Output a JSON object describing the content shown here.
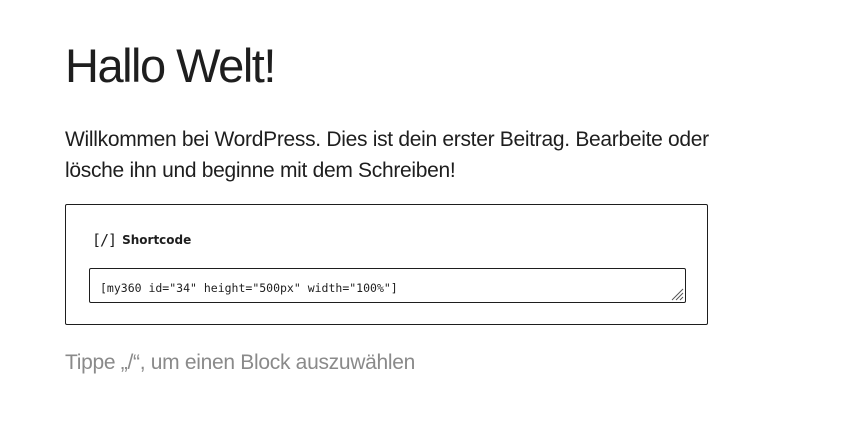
{
  "post": {
    "title": "Hallo Welt!",
    "paragraph": "Willkommen bei WordPress. Dies ist dein erster Beitrag. Bearbeite oder lösche ihn und beginne mit dem Schreiben!"
  },
  "shortcode_block": {
    "icon_glyph": "[/]",
    "icon_name": "shortcode-icon",
    "label": "Shortcode",
    "value": "[my360 id=\"34\" height=\"500px\" width=\"100%\"]"
  },
  "placeholder": {
    "text": "Tippe „/“, um einen Block auszuwählen"
  },
  "colors": {
    "text": "#1e1e1e",
    "placeholder": "#8a8a8a",
    "border": "#1e1e1e",
    "background": "#ffffff"
  }
}
